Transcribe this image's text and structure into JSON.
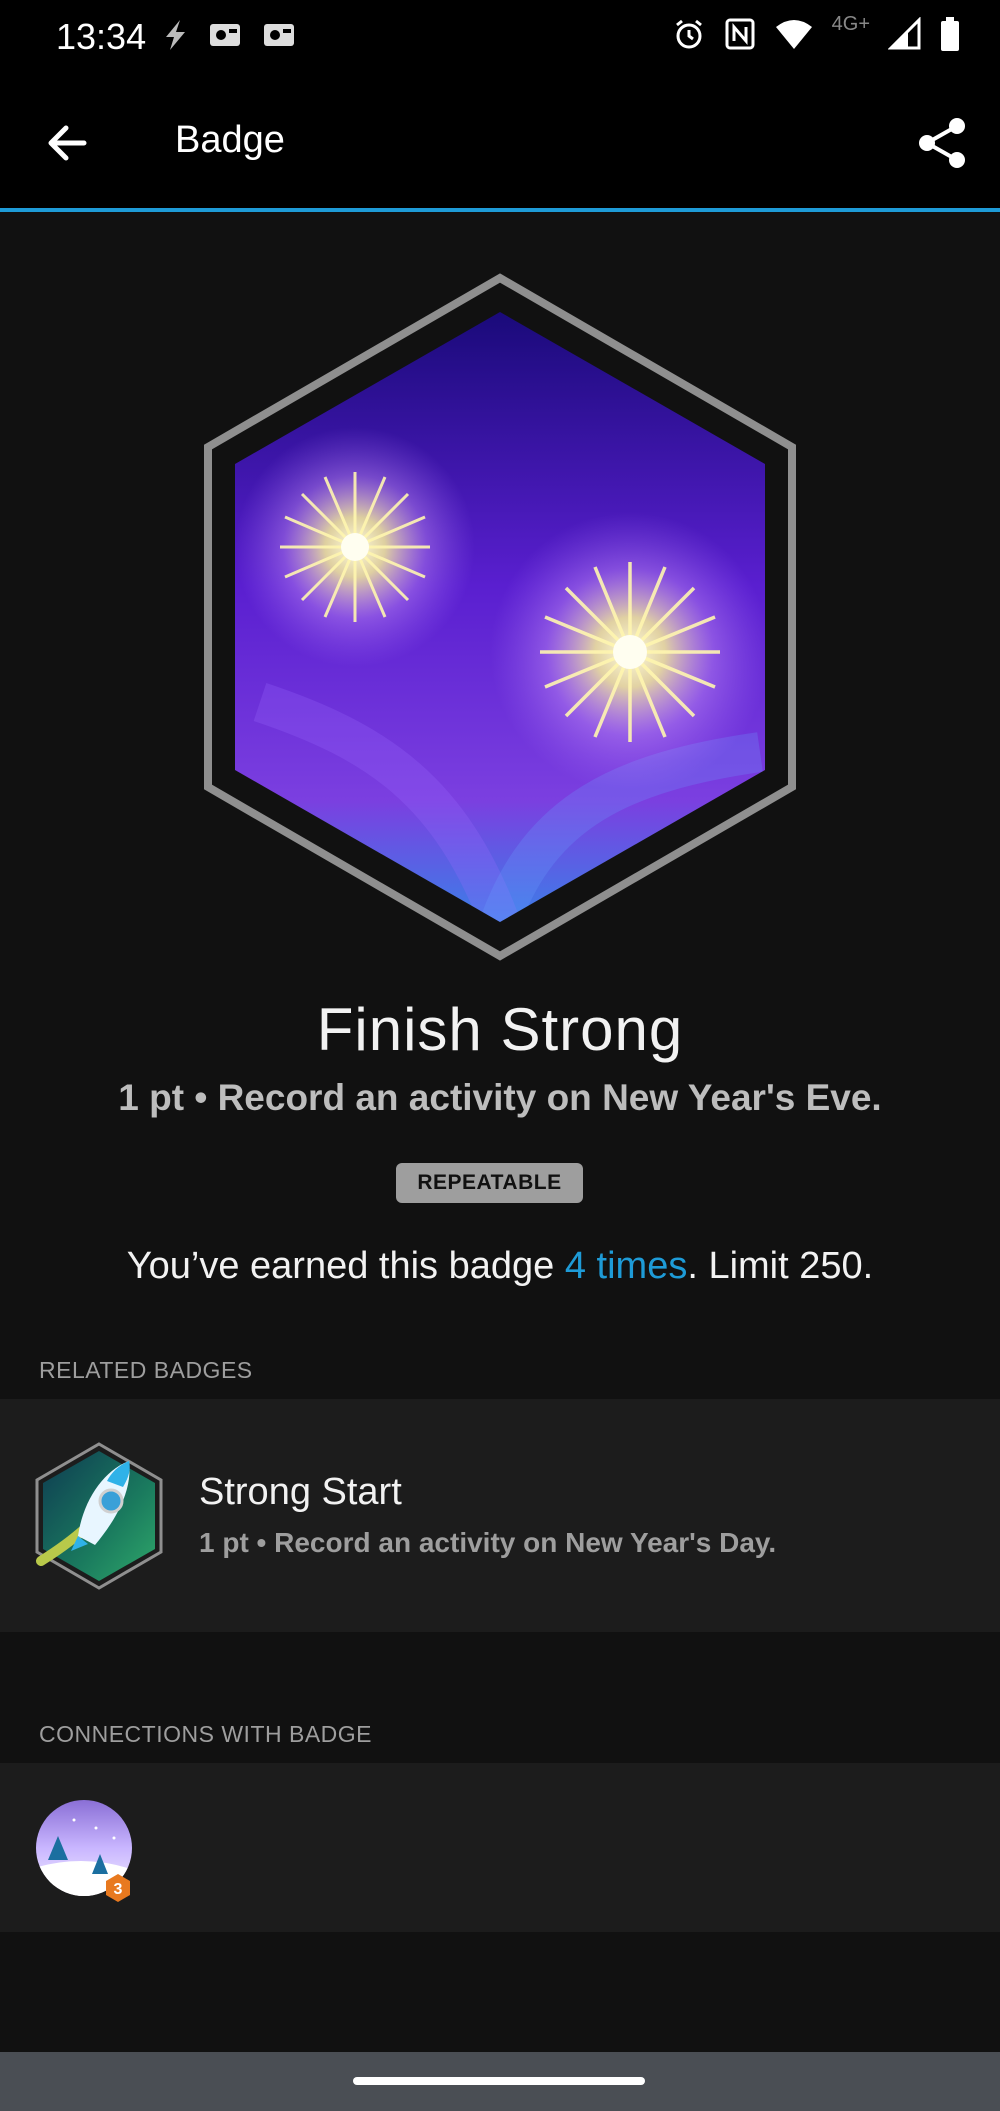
{
  "status_bar": {
    "time": "13:34",
    "network": "4G+",
    "left_icons": [
      "flash-icon",
      "photo-icon",
      "photo-icon"
    ],
    "right_icons": [
      "alarm-icon",
      "nfc-icon",
      "wifi-icon",
      "signal-icon",
      "battery-icon"
    ]
  },
  "app_bar": {
    "title": "Badge",
    "back_icon": "arrow-back-icon",
    "share_icon": "share-icon",
    "accent_color": "#1e9bd7"
  },
  "badge": {
    "name": "Finish Strong",
    "description": "1 pt • Record an activity on New Year's Eve.",
    "tag": "REPEATABLE",
    "earned_prefix": "You’ve earned this badge ",
    "earned_link": "4 times",
    "earned_suffix": ". Limit 250."
  },
  "related": {
    "header": "RELATED BADGES",
    "items": [
      {
        "title": "Strong Start",
        "description": "1 pt • Record an activity on New Year's Day."
      }
    ]
  },
  "connections": {
    "header": "CONNECTIONS WITH BADGE",
    "avatar_count": "3"
  }
}
